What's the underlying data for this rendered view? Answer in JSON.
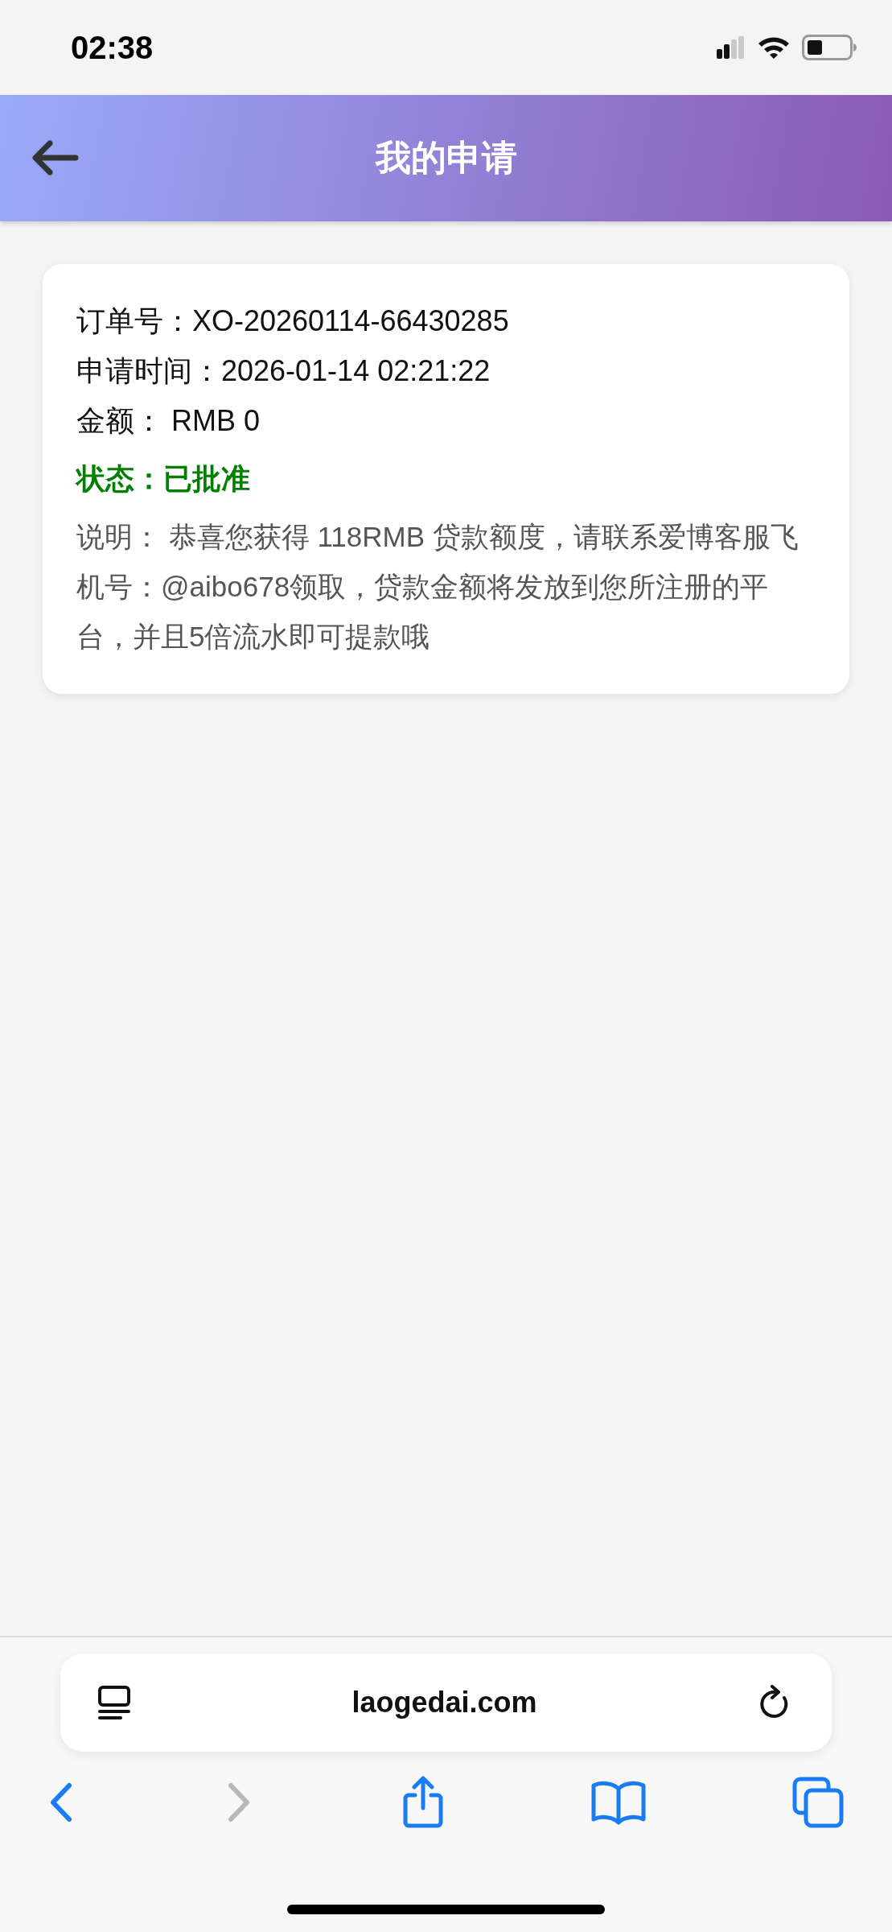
{
  "status_bar": {
    "time": "02:38"
  },
  "header": {
    "title": "我的申请"
  },
  "application": {
    "fields": [
      {
        "label": "订单号：",
        "value": "XO-20260114-66430285"
      },
      {
        "label": "申请时间：",
        "value": "2026-01-14 02:21:22"
      },
      {
        "label": "金额：",
        "value": " RMB 0"
      }
    ],
    "status": {
      "label": "状态：",
      "value": "已批准",
      "color": "#008000"
    },
    "description": {
      "label": "说明：",
      "value": " 恭喜您获得 118RMB 贷款额度，请联系爱博客服飞机号：@aibo678领取，贷款金额将发放到您所注册的平台，并且5倍流水即可提款哦"
    }
  },
  "browser": {
    "address": "laogedai.com",
    "toolbar": [
      {
        "kind": "back",
        "disabled": false
      },
      {
        "kind": "forward",
        "disabled": true
      },
      {
        "kind": "share",
        "disabled": false
      },
      {
        "kind": "bookmarks",
        "disabled": false
      },
      {
        "kind": "tabs",
        "disabled": false
      }
    ]
  }
}
